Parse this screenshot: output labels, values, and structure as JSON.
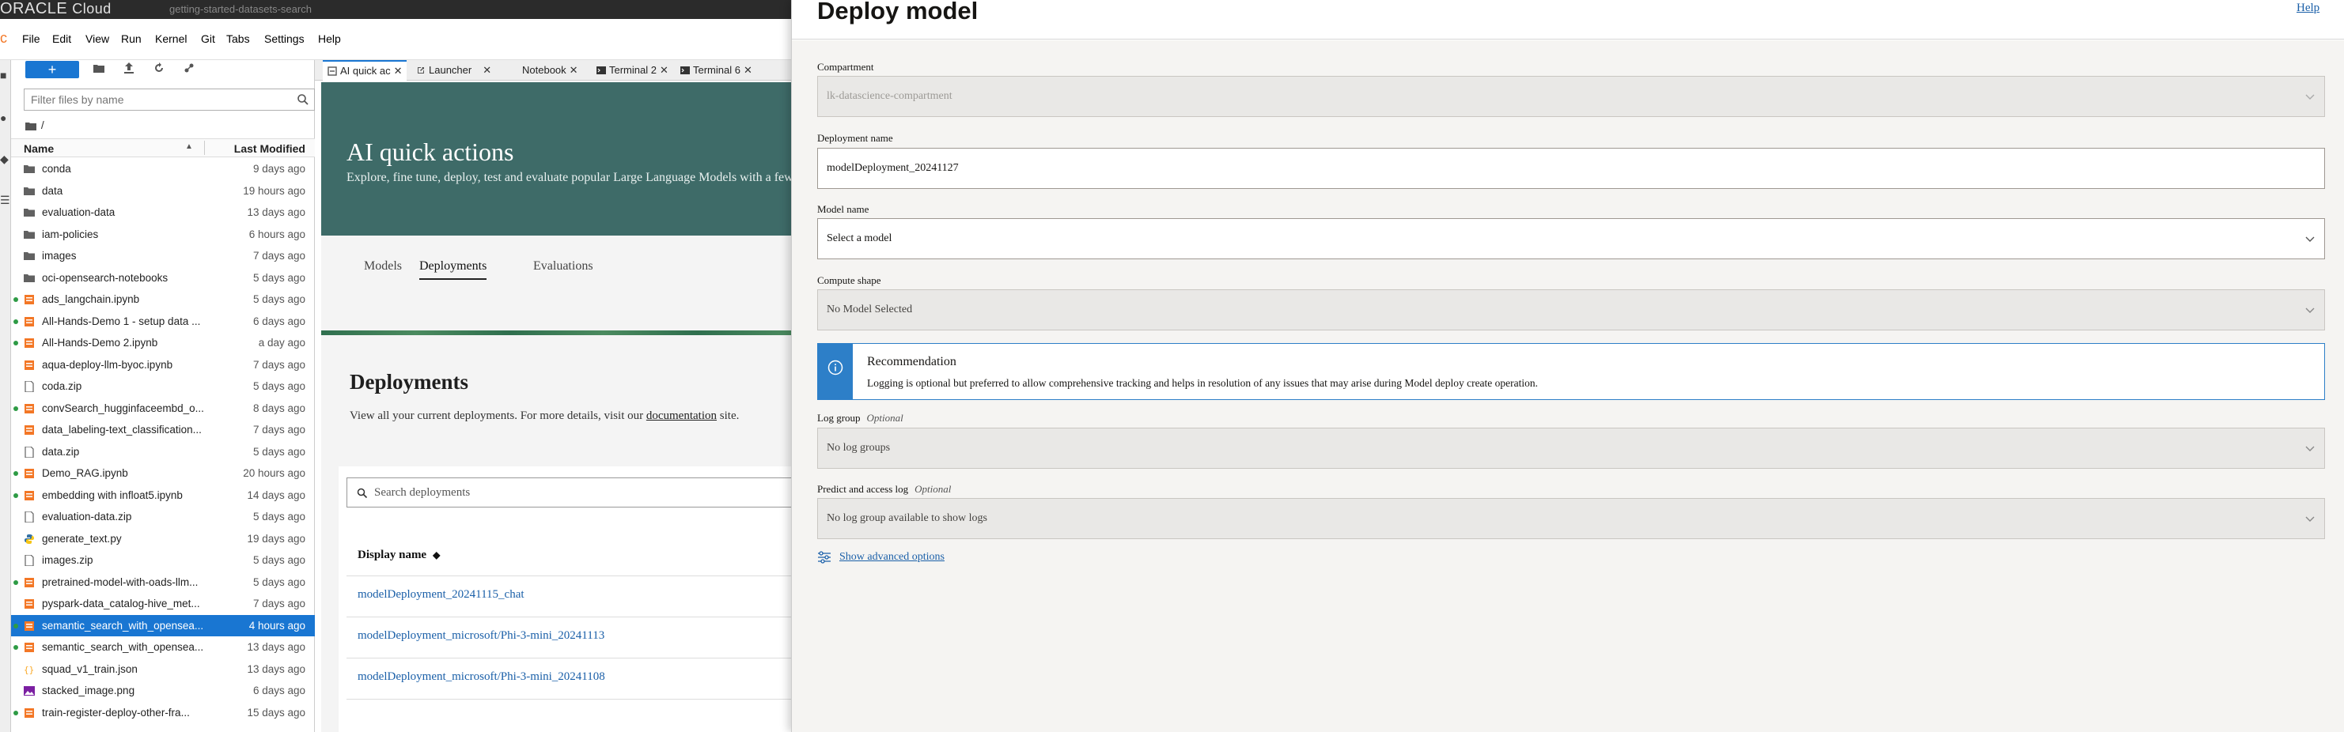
{
  "topbar": {
    "brand": "ORACLE",
    "brand_suffix": "Cloud",
    "notebook_file": "getting-started-datasets-search"
  },
  "menubar": {
    "items": [
      "File",
      "Edit",
      "View",
      "Run",
      "Kernel",
      "Git",
      "Tabs",
      "Settings",
      "Help"
    ]
  },
  "filebrowser": {
    "new_label": "+",
    "filter_placeholder": "Filter files by name",
    "breadcrumb": "/",
    "columns": {
      "name": "Name",
      "modified": "Last Modified"
    },
    "items": [
      {
        "name": "conda",
        "modified": "9 days ago",
        "type": "folder",
        "running": false
      },
      {
        "name": "data",
        "modified": "19 hours ago",
        "type": "folder",
        "running": false
      },
      {
        "name": "evaluation-data",
        "modified": "13 days ago",
        "type": "folder",
        "running": false
      },
      {
        "name": "iam-policies",
        "modified": "6 hours ago",
        "type": "folder",
        "running": false
      },
      {
        "name": "images",
        "modified": "7 days ago",
        "type": "folder",
        "running": false
      },
      {
        "name": "oci-opensearch-notebooks",
        "modified": "5 days ago",
        "type": "folder",
        "running": false
      },
      {
        "name": "ads_langchain.ipynb",
        "modified": "5 days ago",
        "type": "notebook",
        "running": true
      },
      {
        "name": "All-Hands-Demo 1 - setup data ...",
        "modified": "6 days ago",
        "type": "notebook",
        "running": true
      },
      {
        "name": "All-Hands-Demo 2.ipynb",
        "modified": "a day ago",
        "type": "notebook",
        "running": true
      },
      {
        "name": "aqua-deploy-llm-byoc.ipynb",
        "modified": "7 days ago",
        "type": "notebook",
        "running": false
      },
      {
        "name": "coda.zip",
        "modified": "5 days ago",
        "type": "file",
        "running": false
      },
      {
        "name": "convSearch_hugginfaceembd_o...",
        "modified": "8 days ago",
        "type": "notebook",
        "running": true
      },
      {
        "name": "data_labeling-text_classification...",
        "modified": "7 days ago",
        "type": "notebook",
        "running": false
      },
      {
        "name": "data.zip",
        "modified": "5 days ago",
        "type": "file",
        "running": false
      },
      {
        "name": "Demo_RAG.ipynb",
        "modified": "20 hours ago",
        "type": "notebook",
        "running": true
      },
      {
        "name": "embedding with infloat5.ipynb",
        "modified": "14 days ago",
        "type": "notebook",
        "running": true
      },
      {
        "name": "evaluation-data.zip",
        "modified": "5 days ago",
        "type": "file",
        "running": false
      },
      {
        "name": "generate_text.py",
        "modified": "19 days ago",
        "type": "python",
        "running": false
      },
      {
        "name": "images.zip",
        "modified": "5 days ago",
        "type": "file",
        "running": false
      },
      {
        "name": "pretrained-model-with-oads-llm...",
        "modified": "5 days ago",
        "type": "notebook",
        "running": true
      },
      {
        "name": "pyspark-data_catalog-hive_met...",
        "modified": "7 days ago",
        "type": "notebook",
        "running": false
      },
      {
        "name": "semantic_search_with_opensea...",
        "modified": "4 hours ago",
        "type": "notebook",
        "running": true,
        "selected": true
      },
      {
        "name": "semantic_search_with_opensea...",
        "modified": "13 days ago",
        "type": "notebook",
        "running": true
      },
      {
        "name": "squad_v1_train.json",
        "modified": "13 days ago",
        "type": "json",
        "running": false
      },
      {
        "name": "stacked_image.png",
        "modified": "6 days ago",
        "type": "image",
        "running": false
      },
      {
        "name": "train-register-deploy-other-fra...",
        "modified": "15 days ago",
        "type": "notebook",
        "running": true
      }
    ]
  },
  "tabs": [
    {
      "label": "AI quick ac",
      "active": true
    },
    {
      "label": "Launcher",
      "active": false
    },
    {
      "label": "Notebook",
      "active": false
    },
    {
      "label": "Terminal 2",
      "active": false
    },
    {
      "label": "Terminal 6",
      "active": false
    }
  ],
  "aqa": {
    "title": "AI quick actions",
    "subtitle": "Explore, fine tune, deploy, test and evaluate popular Large Language Models with a few",
    "nav": [
      "Models",
      "Deployments",
      "Evaluations"
    ],
    "deployments_title": "Deployments",
    "deployments_sub_prefix": "View all your current deployments. For more details, visit our",
    "deployments_sub_link": "documentation",
    "deployments_sub_suffix": "site.",
    "search_placeholder": "Search deployments",
    "column": "Display name",
    "rows": [
      "modelDeployment_20241115_chat",
      "modelDeployment_microsoft/Phi-3-mini_20241113",
      "modelDeployment_microsoft/Phi-3-mini_20241108"
    ]
  },
  "drawer": {
    "title": "Deploy model",
    "help": "Help",
    "compartment": {
      "label": "Compartment",
      "value": "lk-datascience-compartment"
    },
    "deployment_name": {
      "label": "Deployment name",
      "value": "modelDeployment_20241127"
    },
    "model_name": {
      "label": "Model name",
      "value": "Select a model"
    },
    "compute_shape": {
      "label": "Compute shape",
      "value": "No Model Selected"
    },
    "recommendation": {
      "title": "Recommendation",
      "text": "Logging is optional but preferred to allow comprehensive tracking and helps in resolution of any issues that may arise during Model deploy create operation."
    },
    "log_group": {
      "label": "Log group",
      "optional": "Optional",
      "value": "No log groups"
    },
    "predict_log": {
      "label": "Predict and access log",
      "optional": "Optional",
      "value": "No log group available to show logs"
    },
    "advanced": "Show advanced options"
  },
  "colors": {
    "accent": "#1976d2",
    "hero": "#3e6b68",
    "link": "#1a5fa8",
    "info": "#2d7fc8",
    "running": "#2e9b45"
  }
}
